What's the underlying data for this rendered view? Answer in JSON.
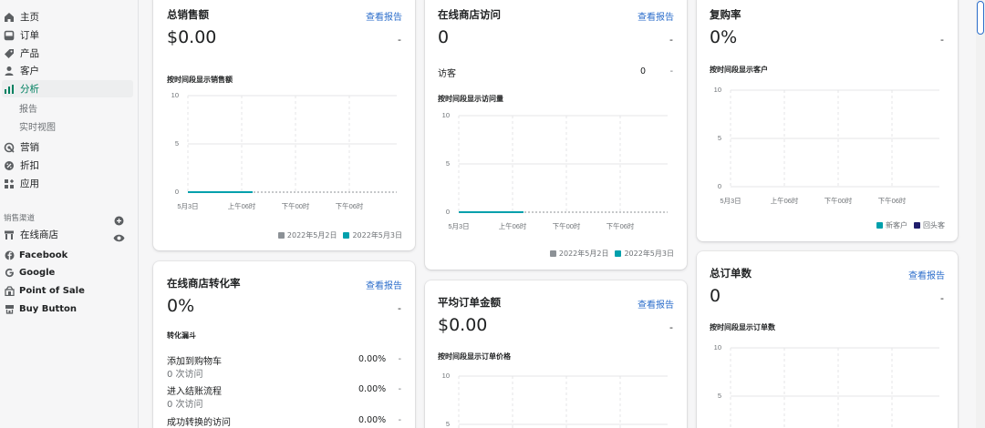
{
  "sidebar": {
    "items": [
      {
        "label": "主页",
        "icon": "home-icon"
      },
      {
        "label": "订单",
        "icon": "orders-icon"
      },
      {
        "label": "产品",
        "icon": "tag-icon"
      },
      {
        "label": "客户",
        "icon": "person-icon"
      },
      {
        "label": "分析",
        "icon": "analytics-icon",
        "active": true
      },
      {
        "label": "营销",
        "icon": "marketing-icon"
      },
      {
        "label": "折扣",
        "icon": "discount-icon"
      },
      {
        "label": "应用",
        "icon": "apps-icon"
      }
    ],
    "sub_items": [
      "报告",
      "实时视图"
    ],
    "channels_label": "销售渠道",
    "online_store": "在线商店",
    "channels": [
      "Facebook",
      "Google",
      "Point of Sale",
      "Buy Button"
    ],
    "accent_color": "#008060"
  },
  "cards": {
    "total_sales": {
      "title": "总销售额",
      "link": "查看报告",
      "value": "$0.00",
      "dash": "-",
      "subtitle": "按时间段显示销售额",
      "yticks": [
        "10",
        "5",
        "0"
      ],
      "xticks": [
        "5月3日",
        "上午06时",
        "下午00时",
        "下午06时"
      ],
      "legend": [
        "2022年5月2日",
        "2022年5月3日"
      ]
    },
    "store_visits": {
      "title": "在线商店访问",
      "link": "查看报告",
      "value": "0",
      "dash": "-",
      "row_label": "访客",
      "row_value": "0",
      "row_dash": "-",
      "subtitle": "按时间段显示访问量",
      "yticks": [
        "10",
        "5",
        "0"
      ],
      "xticks": [
        "5月3日",
        "上午06时",
        "下午00时",
        "下午06时"
      ],
      "legend": [
        "2022年5月2日",
        "2022年5月3日"
      ]
    },
    "repeat_rate": {
      "title": "复购率",
      "value": "0%",
      "dash": "-",
      "subtitle": "按时间段显示客户",
      "yticks": [
        "10",
        "5",
        "0"
      ],
      "xticks": [
        "5月3日",
        "上午06时",
        "下午00时",
        "下午06时"
      ],
      "legend": [
        "新客户",
        "回头客"
      ]
    },
    "conversion_rate": {
      "title": "在线商店转化率",
      "link": "查看报告",
      "value": "0%",
      "dash": "-",
      "subtitle": "转化漏斗",
      "rows": [
        {
          "label": "添加到购物车",
          "sub": "0 次访问",
          "value": "0.00%",
          "dash": "-"
        },
        {
          "label": "进入结账流程",
          "sub": "0 次访问",
          "value": "0.00%",
          "dash": "-"
        },
        {
          "label": "成功转换的访问",
          "value": "0.00%",
          "dash": "-"
        }
      ]
    },
    "avg_order_value": {
      "title": "平均订单金额",
      "link": "查看报告",
      "value": "$0.00",
      "dash": "-",
      "subtitle": "按时间段显示订单价格",
      "yticks": [
        "10",
        "5"
      ]
    },
    "total_orders": {
      "title": "总订单数",
      "link": "查看报告",
      "value": "0",
      "dash": "-",
      "subtitle": "按时间段显示订单数",
      "yticks": [
        "10",
        "5"
      ]
    }
  },
  "colors": {
    "link": "#2c6ecb",
    "series_prev": "#8c9196",
    "series_curr": "#00a0ac",
    "new_customer": "#00a0ac",
    "returning_customer": "#1f1d6b"
  }
}
